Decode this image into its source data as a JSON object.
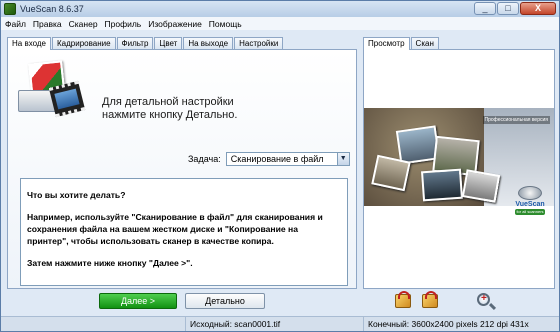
{
  "window": {
    "title": "VueScan 8.6.37",
    "minimize": "_",
    "maximize": "□",
    "close": "X"
  },
  "menu": [
    "Файл",
    "Правка",
    "Сканер",
    "Профиль",
    "Изображение",
    "Помощь"
  ],
  "left_tabs": [
    "На входе",
    "Кадрирование",
    "Фильтр",
    "Цвет",
    "На выходе",
    "Настройки"
  ],
  "right_tabs": [
    "Просмотр",
    "Скан"
  ],
  "hint": {
    "line1": "Для детальной настройки",
    "line2": "нажмите кнопку Детально."
  },
  "task": {
    "label": "Задача:",
    "value": "Сканирование в файл",
    "arrow": "▼"
  },
  "help": {
    "question": "Что вы хотите делать?",
    "paragraph": "Например, используйте \"Сканирование в файл\" для сканирования и сохранения файла на вашем жестком диске и \"Копирование на принтер\", чтобы использовать сканер в качестве копира.",
    "next_step": "Затем нажмите ниже кнопку \"Далее >\"."
  },
  "preview": {
    "banner_text": "Профессиональная версия",
    "logo_word": "VueScan",
    "logo_ribbon": "for all scanners"
  },
  "buttons": {
    "next": "Далее >",
    "detail": "Детально"
  },
  "status": {
    "source": "Исходный:  scan0001.tif",
    "target": "Конечный: 3600x2400 pixels 212 dpi 431x"
  },
  "icons": [
    "app-icon",
    "rotate-left-icon",
    "rotate-right-icon",
    "zoom-in-icon"
  ]
}
